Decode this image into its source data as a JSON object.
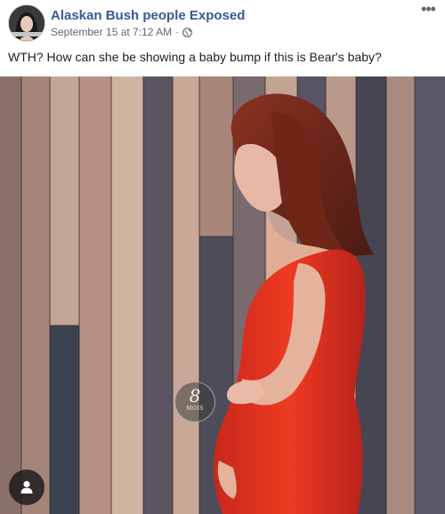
{
  "post": {
    "page_name": "Alaskan Bush people Exposed",
    "timestamp": "September 15 at 7:12 AM",
    "separator": "·",
    "audience_icon": "globe-icon",
    "more_icon": "more-horizontal-icon",
    "more_label": "•••",
    "text": "WTH? How can she be showing a baby bump if this is Bear's baby?"
  },
  "photo": {
    "overlay_logo": {
      "number": "8",
      "sub": "MOIS"
    },
    "tag_icon": "person-tag-icon"
  },
  "colors": {
    "page_name": "#385898",
    "meta": "#616770",
    "dress": "#e0331f",
    "hair": "#7a2a1a"
  }
}
